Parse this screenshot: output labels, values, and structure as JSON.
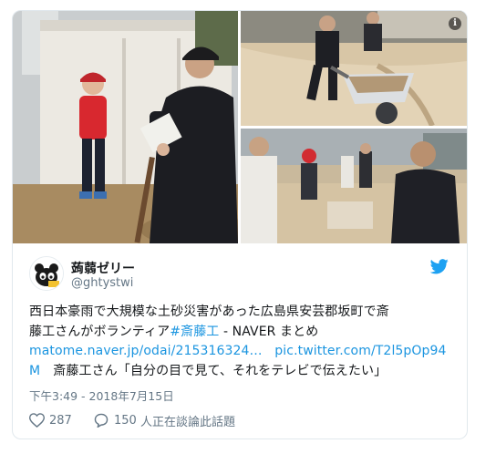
{
  "tweet": {
    "author_name": "蒟蒻ゼリー",
    "author_handle": "@ghtystwi",
    "text_line1": "西日本豪雨で大規模な土砂災害があった広島県安芸郡坂町で斎",
    "text_line2_a": "藤工さんがボランティア",
    "hashtag": "#斎藤工",
    "text_line2_b": " - NAVER まとめ",
    "link1": "matome.naver.jp/odai/215316324…",
    "link2_a": "pic.twitter.com/T2l5pOp94",
    "link2_b": "M",
    "text_line4": "　斎藤工さん「自分の目で見て、それをテレビで伝えたい」",
    "timestamp": "下午3:49 - 2018年7月15日",
    "likes": "287",
    "replies": "150",
    "replies_label": "人正在談論此話題"
  },
  "media": {
    "info_glyph": "i",
    "icons": [
      "info-icon",
      "twitter-bird-icon",
      "heart-icon",
      "reply-bubble-icon"
    ],
    "colors": {
      "link": "#1b95e0",
      "twitter_blue": "#1da1f2",
      "muted": "#657786"
    }
  }
}
